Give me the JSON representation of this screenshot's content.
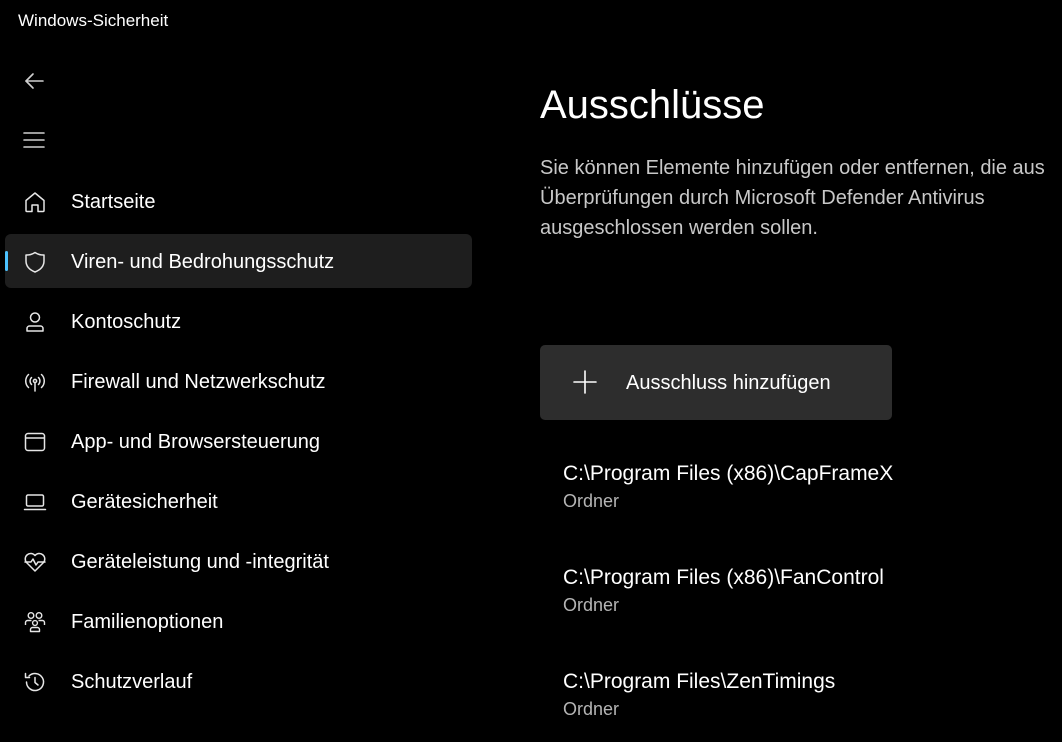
{
  "window": {
    "title": "Windows-Sicherheit"
  },
  "nav": {
    "back_icon": "back-arrow-icon",
    "menu_icon": "hamburger-menu-icon",
    "items": [
      {
        "label": "Startseite",
        "icon": "home-icon",
        "active": false
      },
      {
        "label": "Viren- und Bedrohungsschutz",
        "icon": "shield-icon",
        "active": true
      },
      {
        "label": "Kontoschutz",
        "icon": "person-icon",
        "active": false
      },
      {
        "label": "Firewall und Netzwerkschutz",
        "icon": "wireless-icon",
        "active": false
      },
      {
        "label": "App- und Browsersteuerung",
        "icon": "app-window-icon",
        "active": false
      },
      {
        "label": "Gerätesicherheit",
        "icon": "laptop-icon",
        "active": false
      },
      {
        "label": "Geräteleistung und -integrität",
        "icon": "heart-pulse-icon",
        "active": false
      },
      {
        "label": "Familienoptionen",
        "icon": "family-icon",
        "active": false
      },
      {
        "label": "Schutzverlauf",
        "icon": "history-icon",
        "active": false
      }
    ]
  },
  "main": {
    "title": "Ausschlüsse",
    "description": "Sie können Elemente hinzufügen oder entfernen, die aus Überprüfungen durch Microsoft Defender Antivirus ausgeschlossen werden sollen.",
    "add_button_label": "Ausschluss hinzufügen",
    "exclusions": [
      {
        "path": "C:\\Program Files (x86)\\CapFrameX",
        "type": "Ordner"
      },
      {
        "path": "C:\\Program Files (x86)\\FanControl",
        "type": "Ordner"
      },
      {
        "path": "C:\\Program Files\\ZenTimings",
        "type": "Ordner"
      }
    ]
  },
  "colors": {
    "background": "#000000",
    "active_item_bg": "#1e1e1e",
    "accent": "#4cc2ff",
    "button_bg": "#2d2d2d"
  }
}
